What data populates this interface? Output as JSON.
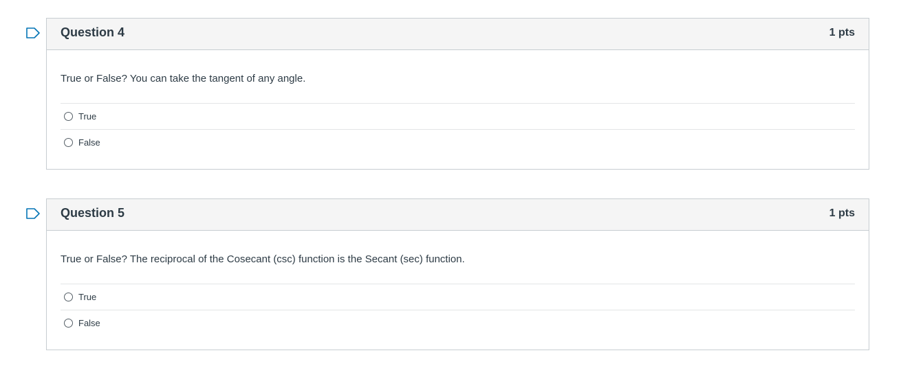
{
  "accent_color": "#0374b5",
  "questions": [
    {
      "flag_icon": "flag-outline-icon",
      "title": "Question 4",
      "points": "1 pts",
      "text": "True or False? You can take the tangent of any angle.",
      "answers": [
        {
          "label": "True"
        },
        {
          "label": "False"
        }
      ]
    },
    {
      "flag_icon": "flag-outline-icon",
      "title": "Question 5",
      "points": "1 pts",
      "text": "True or False?  The reciprocal of the Cosecant (csc) function is the Secant (sec) function.",
      "answers": [
        {
          "label": "True"
        },
        {
          "label": "False"
        }
      ]
    }
  ]
}
